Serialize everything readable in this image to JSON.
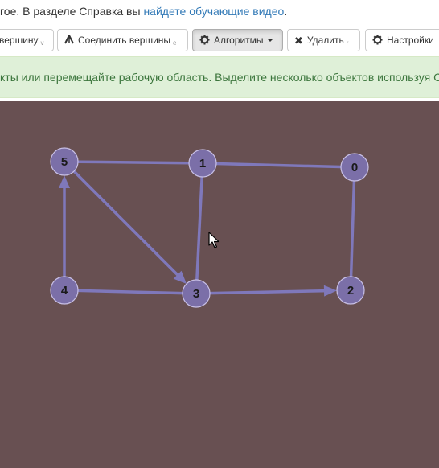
{
  "help": {
    "prefix": "гое. В разделе Справка вы ",
    "link": "найдете обучающие видео",
    "suffix": "."
  },
  "toolbar": {
    "buttons": [
      {
        "label": "вершину",
        "hotkey": "v",
        "icon": "add-vertex-icon"
      },
      {
        "label": "Соединить вершины",
        "hotkey": "e",
        "icon": "connect-edge-icon"
      },
      {
        "label": "Алгоритмы",
        "hotkey": "",
        "icon": "gear-icon",
        "dropdown": true,
        "active": true
      },
      {
        "label": "Удалить",
        "hotkey": "r",
        "icon": "close-icon"
      },
      {
        "label": "Настройки",
        "hotkey": "",
        "icon": "gear-icon"
      }
    ]
  },
  "info": {
    "text": "кты или перемещайте рабочую область. Выделите несколько объектов используя Ctrl"
  },
  "graph": {
    "canvas_color": "#685052",
    "vertex_fill": "#7b6fa8",
    "vertex_stroke": "#c8c0e6",
    "edge_color": "#7f78bb",
    "vertices": [
      {
        "id": "5"
      },
      {
        "id": "1"
      },
      {
        "id": "0"
      },
      {
        "id": "4"
      },
      {
        "id": "3"
      },
      {
        "id": "2"
      }
    ],
    "edges": [
      {
        "from": "5",
        "to": "1",
        "directed": false
      },
      {
        "from": "1",
        "to": "0",
        "directed": false
      },
      {
        "from": "1",
        "to": "3",
        "directed": false
      },
      {
        "from": "0",
        "to": "2",
        "directed": false
      },
      {
        "from": "4",
        "to": "5",
        "directed": true
      },
      {
        "from": "5",
        "to": "3",
        "directed": true
      },
      {
        "from": "4",
        "to": "3",
        "directed": false
      },
      {
        "from": "3",
        "to": "2",
        "directed": true
      }
    ]
  }
}
